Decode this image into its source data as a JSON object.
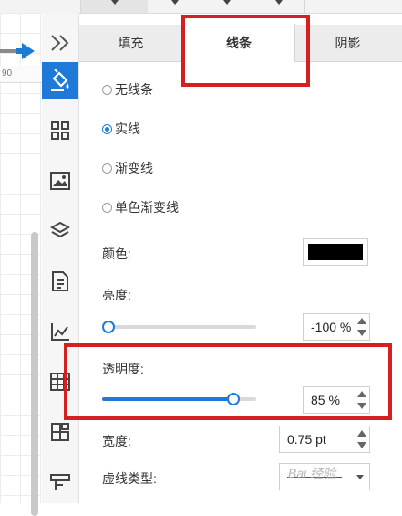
{
  "canvas": {
    "ruler_label": "90"
  },
  "rail": {
    "items": [
      {
        "icon": "double-chevron-right-icon"
      },
      {
        "icon": "paint-bucket-icon",
        "active": true
      },
      {
        "icon": "grid-icon"
      },
      {
        "icon": "image-icon"
      },
      {
        "icon": "layers-icon"
      },
      {
        "icon": "document-icon"
      },
      {
        "icon": "line-chart-icon"
      },
      {
        "icon": "table-icon"
      },
      {
        "icon": "layout-icon"
      },
      {
        "icon": "presentation-icon"
      }
    ]
  },
  "tabs": [
    {
      "label": "填充",
      "active": false
    },
    {
      "label": "线条",
      "active": true
    },
    {
      "label": "阴影",
      "active": false
    }
  ],
  "line_options": [
    {
      "label": "无线条",
      "checked": false
    },
    {
      "label": "实线",
      "checked": true
    },
    {
      "label": "渐变线",
      "checked": false
    },
    {
      "label": "单色渐变线",
      "checked": false
    }
  ],
  "color": {
    "label": "颜色:",
    "value": "#000000"
  },
  "brightness": {
    "label": "亮度:",
    "value_text": "-100 %",
    "slider_level": 0
  },
  "transparency": {
    "label": "透明度:",
    "value_text": "85 %",
    "slider_level": 0.85
  },
  "width": {
    "label": "宽度:",
    "value_text": "0.75 pt"
  },
  "dash": {
    "label": "虚线类型:"
  },
  "watermark": {
    "text": "Bai 经验"
  },
  "colors": {
    "accent": "#1e7ad6",
    "annotation_red": "#d42020"
  }
}
